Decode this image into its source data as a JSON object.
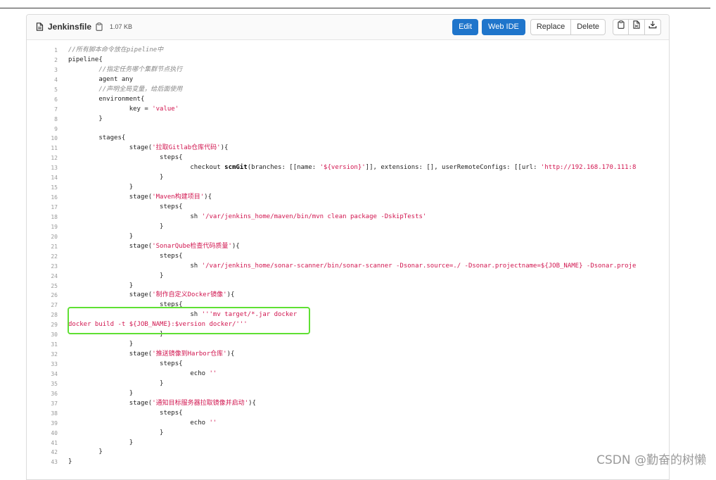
{
  "file": {
    "name": "Jenkinsfile",
    "size": "1.07 KB"
  },
  "toolbar": {
    "edit_label": "Edit",
    "webide_label": "Web IDE",
    "replace_label": "Replace",
    "delete_label": "Delete"
  },
  "icons": {
    "file": "file-icon",
    "copy_path": "copy-path-icon",
    "copy_contents": "copy-contents-icon",
    "raw": "open-raw-icon",
    "download": "download-icon"
  },
  "colors": {
    "primary": "#1f75cb",
    "string": "#d1154f",
    "comment": "#8a8a8a",
    "highlight": "#5fe033"
  },
  "code": {
    "lines": [
      [
        [
          "cm",
          "//所有脚本命令放在pipeline中"
        ]
      ],
      [
        [
          "t",
          "pipeline{"
        ]
      ],
      [
        [
          "t",
          "        "
        ],
        [
          "cm",
          "//指定任务哪个集群节点执行"
        ]
      ],
      [
        [
          "t",
          "        agent any"
        ]
      ],
      [
        [
          "t",
          "        "
        ],
        [
          "cm",
          "//声明全局变量，给后面使用"
        ]
      ],
      [
        [
          "t",
          "        environment{"
        ]
      ],
      [
        [
          "t",
          "                key = "
        ],
        [
          "str",
          "'value'"
        ]
      ],
      [
        [
          "t",
          "        }"
        ]
      ],
      [
        [
          "t",
          ""
        ]
      ],
      [
        [
          "t",
          "        stages{"
        ]
      ],
      [
        [
          "t",
          "                stage("
        ],
        [
          "str",
          "'拉取Gitlab仓库代码'"
        ],
        [
          "t",
          "){"
        ]
      ],
      [
        [
          "t",
          "                        steps{"
        ]
      ],
      [
        [
          "t",
          "                                checkout "
        ],
        [
          "kw",
          "scmGit"
        ],
        [
          "t",
          "(branches: [[name: "
        ],
        [
          "str",
          "'${version}'"
        ],
        [
          "t",
          "]], extensions: [], userRemoteConfigs: [[url: "
        ],
        [
          "str",
          "'http://192.168.170.111:8"
        ]
      ],
      [
        [
          "t",
          "                        }"
        ]
      ],
      [
        [
          "t",
          "                }"
        ]
      ],
      [
        [
          "t",
          "                stage("
        ],
        [
          "str",
          "'Maven构建项目'"
        ],
        [
          "t",
          "){"
        ]
      ],
      [
        [
          "t",
          "                        steps{"
        ]
      ],
      [
        [
          "t",
          "                                sh "
        ],
        [
          "str",
          "'/var/jenkins_home/maven/bin/mvn clean package -DskipTests'"
        ]
      ],
      [
        [
          "t",
          "                        }"
        ]
      ],
      [
        [
          "t",
          "                }"
        ]
      ],
      [
        [
          "t",
          "                stage("
        ],
        [
          "str",
          "'SonarQube检查代码质量'"
        ],
        [
          "t",
          "){"
        ]
      ],
      [
        [
          "t",
          "                        steps{"
        ]
      ],
      [
        [
          "t",
          "                                sh "
        ],
        [
          "str",
          "'/var/jenkins_home/sonar-scanner/bin/sonar-scanner -Dsonar.source=./ -Dsonar.projectname=${JOB_NAME} -Dsonar.proje"
        ]
      ],
      [
        [
          "t",
          "                        }"
        ]
      ],
      [
        [
          "t",
          "                }"
        ]
      ],
      [
        [
          "t",
          "                stage("
        ],
        [
          "str",
          "'制作自定义Docker镜像'"
        ],
        [
          "t",
          "){"
        ]
      ],
      [
        [
          "t",
          "                        steps{"
        ]
      ],
      [
        [
          "t",
          "                                sh "
        ],
        [
          "str",
          "'''mv target/*.jar docker"
        ]
      ],
      [
        [
          "str",
          "docker build -t ${JOB_NAME}:$version docker/'''"
        ]
      ],
      [
        [
          "t",
          "                        }"
        ]
      ],
      [
        [
          "t",
          "                }"
        ]
      ],
      [
        [
          "t",
          "                stage("
        ],
        [
          "str",
          "'推送镜像到Harbor仓库'"
        ],
        [
          "t",
          "){"
        ]
      ],
      [
        [
          "t",
          "                        steps{"
        ]
      ],
      [
        [
          "t",
          "                                echo "
        ],
        [
          "str",
          "''"
        ]
      ],
      [
        [
          "t",
          "                        }"
        ]
      ],
      [
        [
          "t",
          "                }"
        ]
      ],
      [
        [
          "t",
          "                stage("
        ],
        [
          "str",
          "'通知目标服务器拉取镜像并启动'"
        ],
        [
          "t",
          "){"
        ]
      ],
      [
        [
          "t",
          "                        steps{"
        ]
      ],
      [
        [
          "t",
          "                                echo "
        ],
        [
          "str",
          "''"
        ]
      ],
      [
        [
          "t",
          "                        }"
        ]
      ],
      [
        [
          "t",
          "                }"
        ]
      ],
      [
        [
          "t",
          "        }"
        ]
      ],
      [
        [
          "t",
          "}"
        ]
      ]
    ]
  },
  "watermark": "CSDN @勤奋的树懒"
}
